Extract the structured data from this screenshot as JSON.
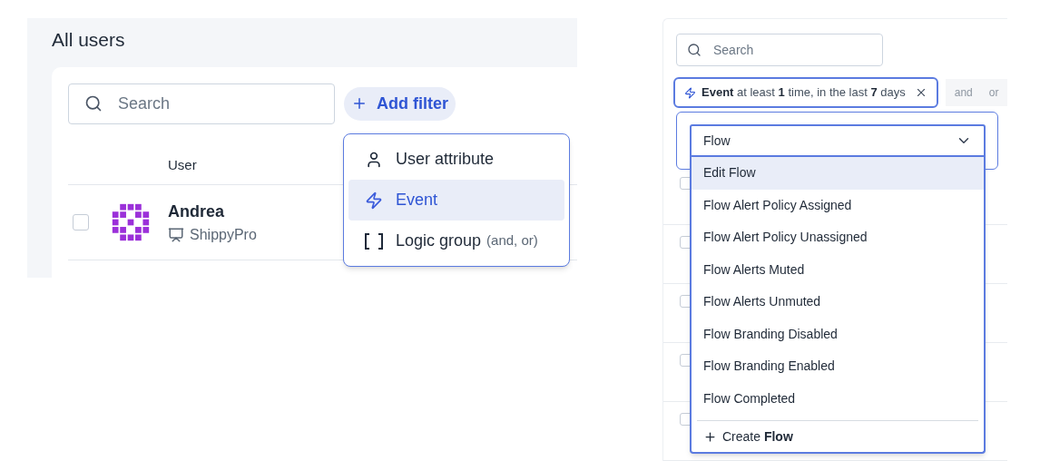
{
  "left": {
    "title": "All users",
    "search": {
      "placeholder": "Search"
    },
    "add_filter": "Add filter",
    "menu": [
      {
        "kind": "user",
        "label": "User attribute",
        "selected": false
      },
      {
        "kind": "event",
        "label": "Event",
        "selected": true
      },
      {
        "kind": "logic",
        "label": "Logic group",
        "hint": "(and, or)",
        "selected": false
      }
    ],
    "table": {
      "columns": [
        "User"
      ],
      "rows": [
        {
          "name": "Andrea",
          "company": "ShippyPro",
          "checked": false
        }
      ]
    }
  },
  "right": {
    "search": {
      "placeholder": "Search"
    },
    "filter_chip": "**Event** at least **1** time, in the last **7** days",
    "logic": [
      "and",
      "or"
    ],
    "combo": {
      "value": "Flow"
    },
    "options": [
      {
        "label": "Edit Flow",
        "selected": true
      },
      {
        "label": "Flow Alert Policy Assigned",
        "selected": false
      },
      {
        "label": "Flow Alert Policy Unassigned",
        "selected": false
      },
      {
        "label": "Flow Alerts Muted",
        "selected": false
      },
      {
        "label": "Flow Alerts Unmuted",
        "selected": false
      },
      {
        "label": "Flow Branding Disabled",
        "selected": false
      },
      {
        "label": "Flow Branding Enabled",
        "selected": false
      },
      {
        "label": "Flow Completed",
        "selected": false
      }
    ],
    "create": "Create **Flow**",
    "rows": [
      {
        "checked": false
      },
      {
        "checked": false
      },
      {
        "checked": false
      },
      {
        "checked": false
      },
      {
        "checked": false
      }
    ]
  }
}
